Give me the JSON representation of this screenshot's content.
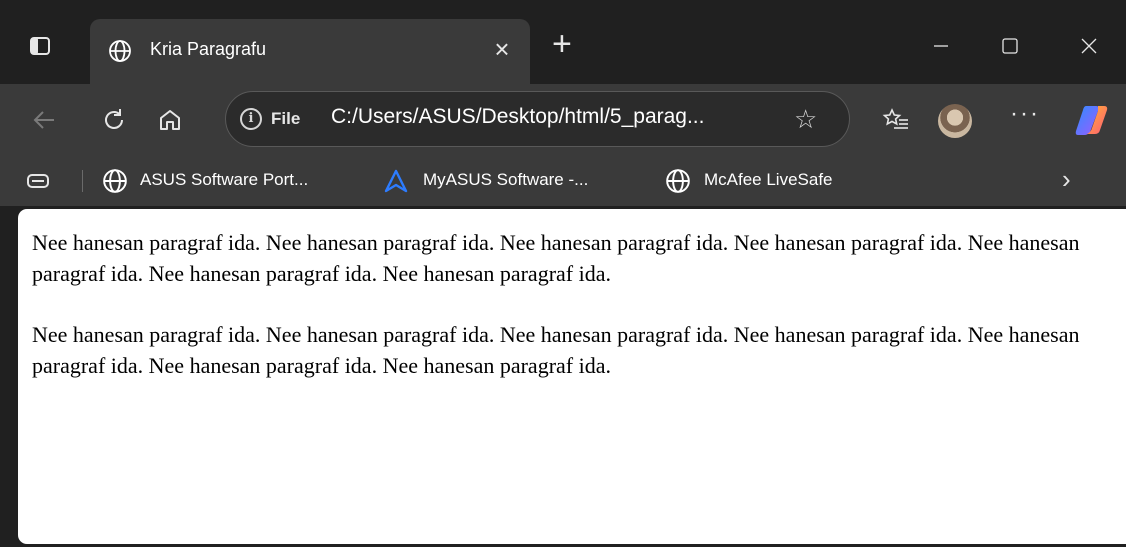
{
  "window": {
    "tab_title": "Kria Paragrafu",
    "tab_icon": "globe-icon",
    "tab_close": "×",
    "new_tab": "+",
    "minimize": "—",
    "maximize": "□",
    "close": "✕"
  },
  "toolbar": {
    "address_prefix": "File",
    "url": "C:/Users/ASUS/Desktop/html/5_parag...",
    "more": "···"
  },
  "bookmarks": {
    "items": [
      {
        "label": "ASUS Software Port...",
        "icon": "globe-icon"
      },
      {
        "label": "MyASUS Software -...",
        "icon": "myasus-icon"
      },
      {
        "label": "McAfee LiveSafe",
        "icon": "globe-icon"
      }
    ],
    "overflow": "›"
  },
  "page": {
    "paragraphs": [
      "Nee hanesan paragraf ida. Nee hanesan paragraf ida. Nee hanesan paragraf ida. Nee hanesan paragraf ida. Nee hanesan paragraf ida. Nee hanesan paragraf ida. Nee hanesan paragraf ida.",
      "Nee hanesan paragraf ida. Nee hanesan paragraf ida. Nee hanesan paragraf ida. Nee hanesan paragraf ida. Nee hanesan paragraf ida. Nee hanesan paragraf ida. Nee hanesan paragraf ida."
    ]
  },
  "colors": {
    "frame": "#202020",
    "toolbar": "#3a3a3a",
    "page_background": "#ffffff",
    "page_text": "#000000"
  }
}
